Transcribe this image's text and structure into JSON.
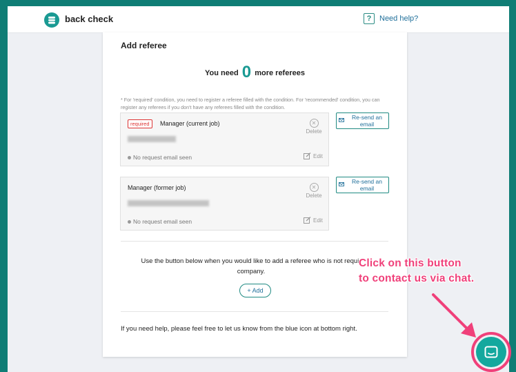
{
  "header": {
    "logo_text": "back check",
    "help_label": "Need help?",
    "help_icon": "?"
  },
  "main": {
    "title": "Add referee",
    "need_prefix": "You need",
    "need_count": "0",
    "need_suffix": "more referees",
    "note": "* For 'required' condition, you need to register a referee filled with the condition. For 'recommended' condition, you can register any referees if you don't have any referees filled with the condition.",
    "referees": [
      {
        "badge": "required",
        "role": "Manager (current job)",
        "delete_label": "Delete",
        "status": "No request email seen",
        "edit_label": "Edit",
        "resend_label": "Re-send an email"
      },
      {
        "badge": "",
        "role": "Manager (former job)",
        "delete_label": "Delete",
        "status": "No request email seen",
        "edit_label": "Edit",
        "resend_label": "Re-send an email"
      }
    ],
    "use_text_line1": "Use the button below when you would like to add a referee who is not requir",
    "use_text_line2": "company.",
    "add_label": "+ Add",
    "footer_help": "If you need help, please feel free to let us know from the blue icon at bottom right."
  },
  "callout": {
    "line1": "Click on this button",
    "line2": "to contact us via chat."
  },
  "colors": {
    "frame": "#0f7d75",
    "accent": "#1a9a93",
    "link": "#1f6f9a",
    "required": "#dd3333",
    "callout": "#f0407a",
    "chat": "#14a89e"
  }
}
